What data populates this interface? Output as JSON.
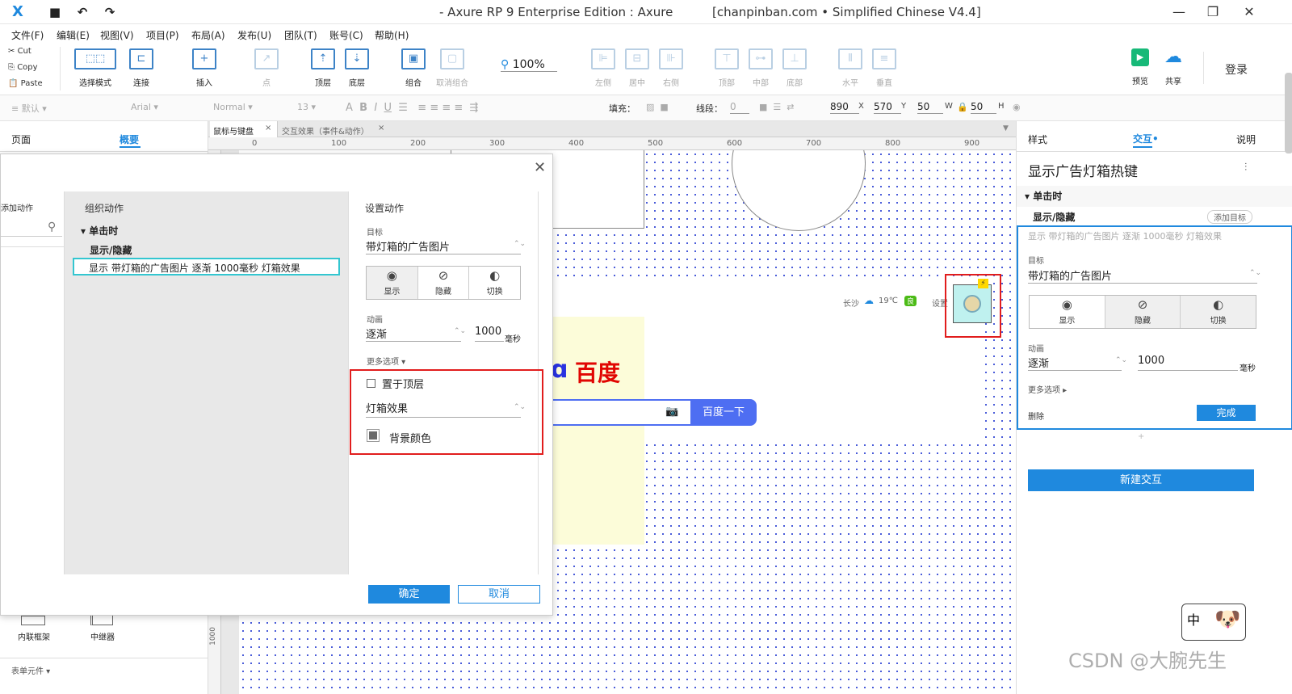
{
  "titlebar": {
    "logo": "X",
    "title": "- Axure RP 9 Enterprise Edition : Axure",
    "subtitle": "[chanpinban.com • Simplified Chinese V4.4]",
    "icons": [
      "save-icon",
      "undo-icon",
      "redo-icon"
    ]
  },
  "menu": [
    "文件(F)",
    "编辑(E)",
    "视图(V)",
    "项目(P)",
    "布局(A)",
    "发布(U)",
    "团队(T)",
    "账号(C)",
    "帮助(H)"
  ],
  "clipboard": {
    "cut": "Cut",
    "copy": "Copy",
    "paste": "Paste"
  },
  "toolbar": {
    "select_mode": "选择模式",
    "connect": "连接",
    "insert": "插入",
    "point": "点",
    "top": "顶层",
    "bottom": "底层",
    "group": "组合",
    "ungroup": "取消组合",
    "zoom": "100%",
    "align": [
      "左侧",
      "居中",
      "右侧",
      "顶部",
      "中部",
      "底部",
      "水平",
      "垂直"
    ],
    "preview": "预览",
    "share": "共享",
    "login": "登录"
  },
  "format": {
    "style": "默认",
    "font": "Arial",
    "weight": "Normal",
    "size": "13",
    "fill_label": "填充：",
    "line_label": "线段：",
    "line_val": "0",
    "x": "890",
    "x_lbl": "X",
    "y": "570",
    "y_lbl": "Y",
    "w": "50",
    "w_lbl": "W",
    "h": "50",
    "h_lbl": "H"
  },
  "left_panel": {
    "tabs": [
      "页面",
      "概要"
    ],
    "widgets": [
      "内联框架",
      "中继器"
    ],
    "section": "表单元件"
  },
  "canvas_tabs": [
    "鼠标与键盘",
    "交互效果（事件&动作）"
  ],
  "ruler_ticks": [
    "0",
    "100",
    "200",
    "300",
    "400",
    "500",
    "600",
    "700",
    "800",
    "900"
  ],
  "canvas": {
    "city": "长沙",
    "temp": "19℃",
    "aqi": "良",
    "setting": "设置",
    "baidu_logo": "百度",
    "search_btn": "百度一下",
    "vruler": "1000"
  },
  "dialog": {
    "add_action": "添加动作",
    "organize": "组织动作",
    "event": "单击时",
    "action": "显示/隐藏",
    "action_detail": "显示 带灯箱的广告图片 逐渐 1000毫秒 灯箱效果",
    "settings": "设置动作",
    "target_label": "目标",
    "target": "带灯箱的广告图片",
    "vis_options": [
      "显示",
      "隐藏",
      "切换"
    ],
    "anim_label": "动画",
    "anim": "逐渐",
    "duration": "1000",
    "unit": "毫秒",
    "more": "更多选项",
    "bring_front": "置于顶层",
    "lightbox": "灯箱效果",
    "bg_color": "背景颜色",
    "ok": "确定",
    "cancel": "取消"
  },
  "right_panel": {
    "tabs": [
      "样式",
      "交互",
      "说明"
    ],
    "title": "显示广告灯箱热键",
    "event": "单击时",
    "action": "显示/隐藏",
    "add_target": "添加目标",
    "summary": "显示 带灯箱的广告图片 逐渐 1000毫秒 灯箱效果",
    "target_label": "目标",
    "target": "带灯箱的广告图片",
    "vis_options": [
      "显示",
      "隐藏",
      "切换"
    ],
    "anim_label": "动画",
    "anim": "逐渐",
    "duration": "1000",
    "unit": "毫秒",
    "more": "更多选项",
    "delete": "删除",
    "done": "完成",
    "new_interaction": "新建交互",
    "ime": "中"
  },
  "watermark": "CSDN @大腕先生",
  "colors": {
    "accent": "#1f89de",
    "highlight": "#e11d1d",
    "dots": "#3b4fd6"
  }
}
